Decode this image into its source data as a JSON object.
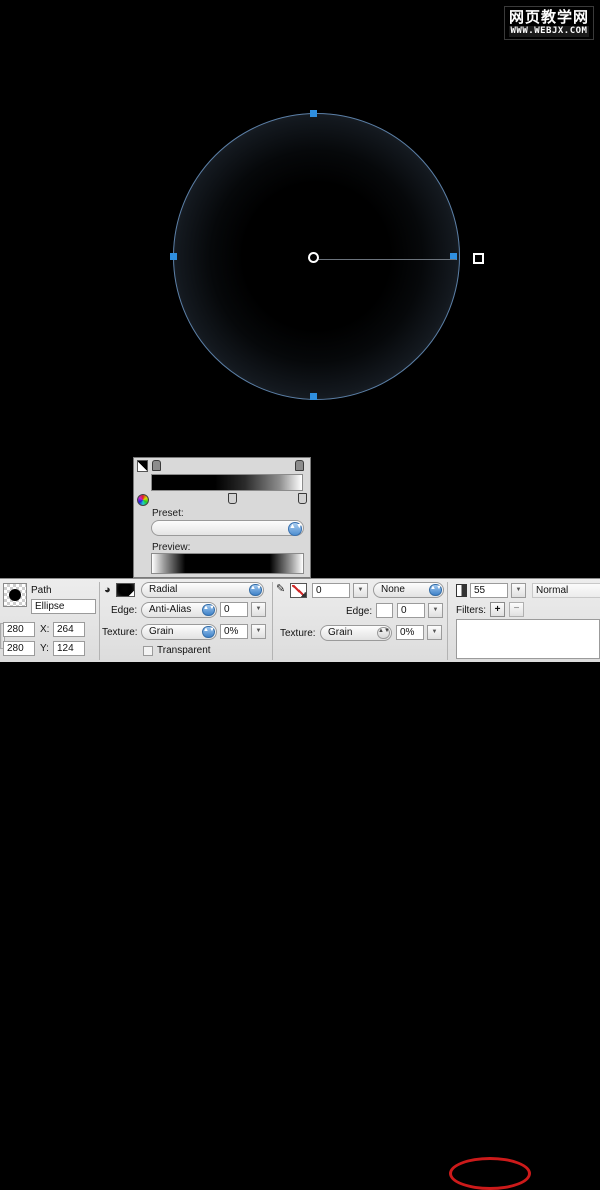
{
  "watermark": {
    "cn_text": "网页教学网",
    "url_text": "WWW.WEBJX.COM"
  },
  "canvas": {
    "shape_name": "ellipse",
    "center_marker": "gradient-center-handle",
    "end_handle": "gradient-end-handle"
  },
  "gradient_popup": {
    "preset_label": "Preset:",
    "preview_label": "Preview:",
    "preset_value": "",
    "ramp_start_color": "#000000",
    "ramp_end_color": "#ffffff",
    "arrow_glyph": "▲▼"
  },
  "properties": {
    "object": {
      "type_label": "Path",
      "name_value": "Ellipse",
      "width_value": "280",
      "height_value": "280",
      "x_label": "X:",
      "x_value": "264",
      "y_label": "Y:",
      "y_value": "124"
    },
    "fill": {
      "category_value": "Radial",
      "edge_label": "Edge:",
      "edge_value": "Anti-Alias",
      "edge_amount": "0",
      "texture_label": "Texture:",
      "texture_value": "Grain",
      "texture_amount": "0%",
      "transparent_label": "Transparent",
      "transparent_checked": false,
      "bucket_icon": "paint-bucket-icon"
    },
    "stroke": {
      "tip_size": "0",
      "category_value": "None",
      "edge_label": "Edge:",
      "edge_value": "0",
      "texture_label": "Texture:",
      "texture_value": "Grain",
      "texture_amount": "0%",
      "pencil_icon": "pencil-icon"
    },
    "appearance": {
      "opacity_value": "55",
      "blend_mode_value": "Normal",
      "filters_label": "Filters:",
      "add_filter_glyph": "+",
      "remove_filter_glyph": "−",
      "arrow_glyph": "▼"
    },
    "annotation": {
      "highlight_color": "#cc1a1a",
      "highlight_target": "opacity-value"
    }
  }
}
